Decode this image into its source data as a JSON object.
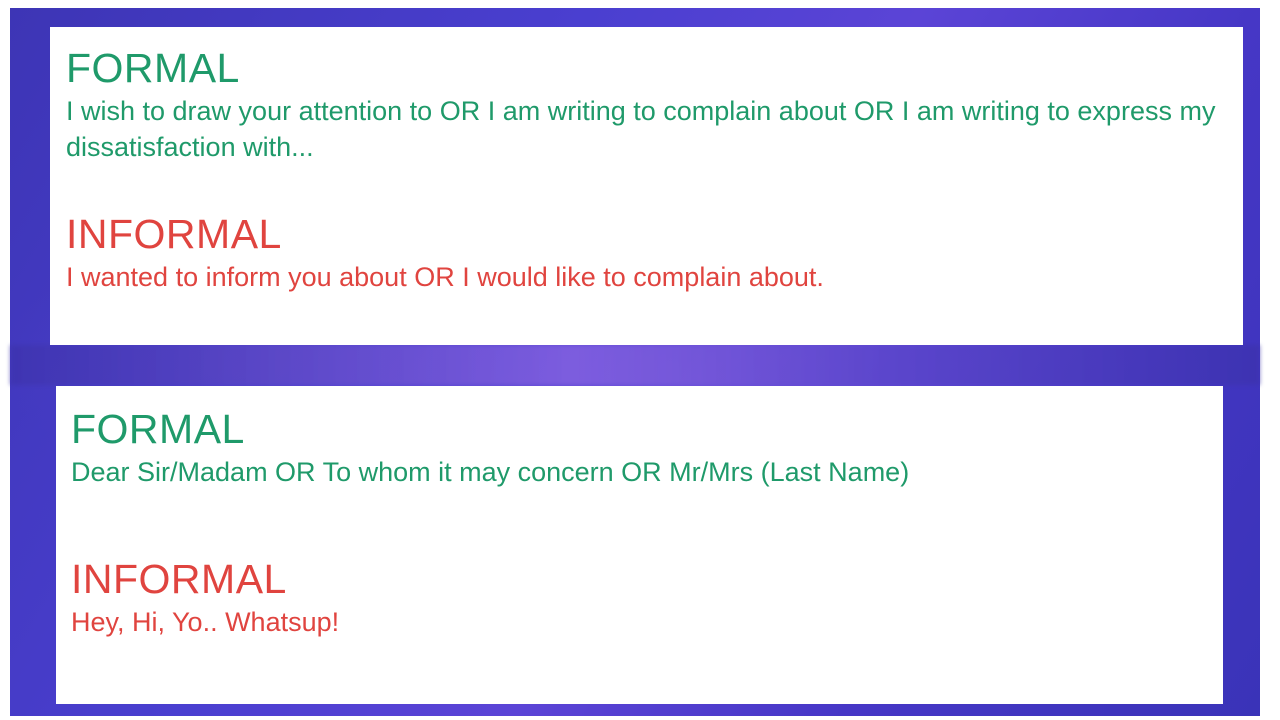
{
  "colors": {
    "formal": "#1f9a6a",
    "informal": "#e0443f",
    "background": "#4a3fd0",
    "card": "#ffffff"
  },
  "cards": [
    {
      "formal": {
        "heading": "FORMAL",
        "text": "I wish to draw your attention to OR I am writing to complain about OR I am writing to express my dissatisfaction with..."
      },
      "informal": {
        "heading": "INFORMAL",
        "text": "I wanted to inform you about OR I would like to complain about."
      }
    },
    {
      "formal": {
        "heading": "FORMAL",
        "text": "Dear Sir/Madam OR To whom it may concern OR Mr/Mrs (Last Name)"
      },
      "informal": {
        "heading": "INFORMAL",
        "text": "Hey, Hi, Yo.. Whatsup!"
      }
    }
  ]
}
